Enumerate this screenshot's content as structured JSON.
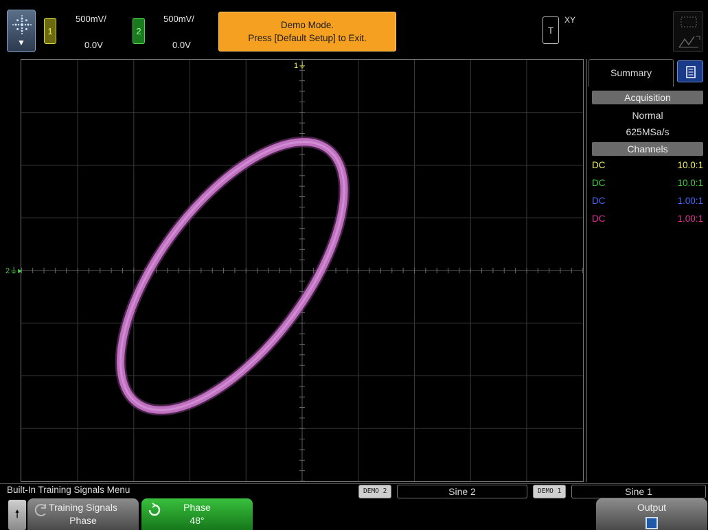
{
  "channel1": {
    "number": "1",
    "scale": "500mV/",
    "offset": "0.0V",
    "color": "#f4f460"
  },
  "channel2": {
    "number": "2",
    "scale": "500mV/",
    "offset": "0.0V",
    "color": "#50d050"
  },
  "demo_banner": {
    "line1": "Demo Mode.",
    "line2": "Press [Default Setup] to Exit."
  },
  "trigger": {
    "label": "T",
    "mode": "XY"
  },
  "markers": {
    "ch1_marker": "1",
    "ch2_marker": "2"
  },
  "trace": {
    "color": "#c070c0",
    "phase_deg": 48
  },
  "panel": {
    "tab_label": "Summary",
    "acquisition": {
      "header": "Acquisition",
      "mode": "Normal",
      "rate": "625MSa/s"
    },
    "channels": {
      "header": "Channels",
      "rows": [
        {
          "coupling": "DC",
          "probe": "10.0:1",
          "color": "#f4f460"
        },
        {
          "coupling": "DC",
          "probe": "10.0:1",
          "color": "#40d040"
        },
        {
          "coupling": "DC",
          "probe": "1.00:1",
          "color": "#4a6aff"
        },
        {
          "coupling": "DC",
          "probe": "1.00:1",
          "color": "#e0309a"
        }
      ]
    }
  },
  "menu": {
    "title": "Built-In Training Signals Menu",
    "demo2_tag": "DEMO 2",
    "demo2_signal": "Sine 2",
    "demo1_tag": "DEMO 1",
    "demo1_signal": "Sine 1"
  },
  "softkeys": {
    "up_icon": "up-arrow-icon",
    "training": {
      "line1": "Training Signals",
      "line2": "Phase"
    },
    "phase": {
      "line1": "Phase",
      "line2": "48°"
    },
    "output": {
      "line1": "Output"
    }
  }
}
